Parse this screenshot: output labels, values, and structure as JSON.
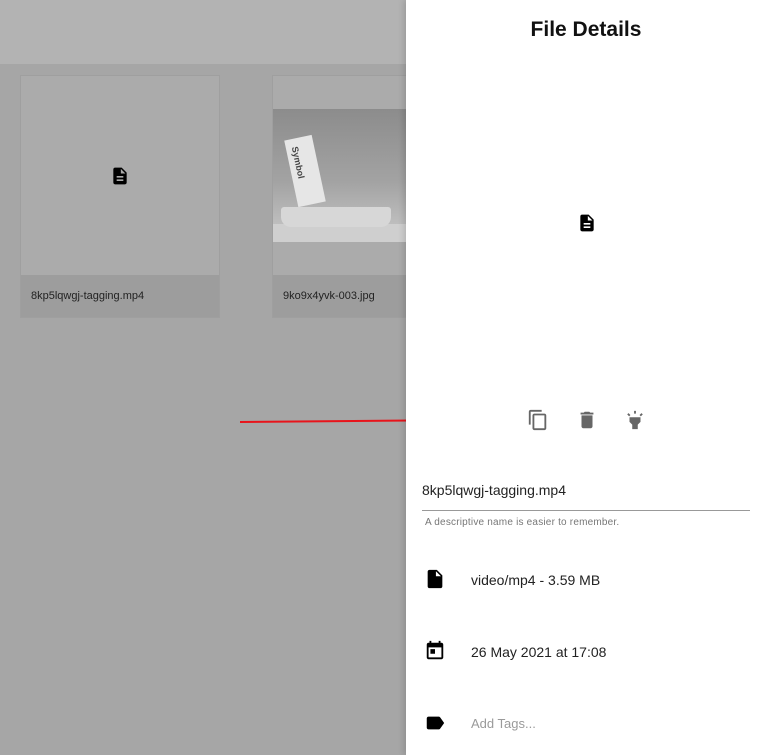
{
  "gallery": {
    "cards": [
      {
        "filename": "8kp5lqwgj-tagging.mp4",
        "thumb_icon": "document-icon"
      },
      {
        "filename": "9ko9x4yvk-003.jpg",
        "thumb_image_text": "Symbol"
      }
    ]
  },
  "panel": {
    "title": "File Details",
    "preview_icon": "document-icon",
    "actions": [
      {
        "name": "copy-icon"
      },
      {
        "name": "trash-icon"
      },
      {
        "name": "spotlight-icon"
      }
    ],
    "name_field": {
      "value": "8kp5lqwgj-tagging.mp4",
      "helper": "A descriptive name is easier to remember."
    },
    "file_info": "video/mp4 - 3.59 MB",
    "date": "26 May 2021 at 17:08",
    "tags_placeholder": "Add Tags..."
  },
  "annotation": {
    "arrow_color": "#e8141b"
  }
}
